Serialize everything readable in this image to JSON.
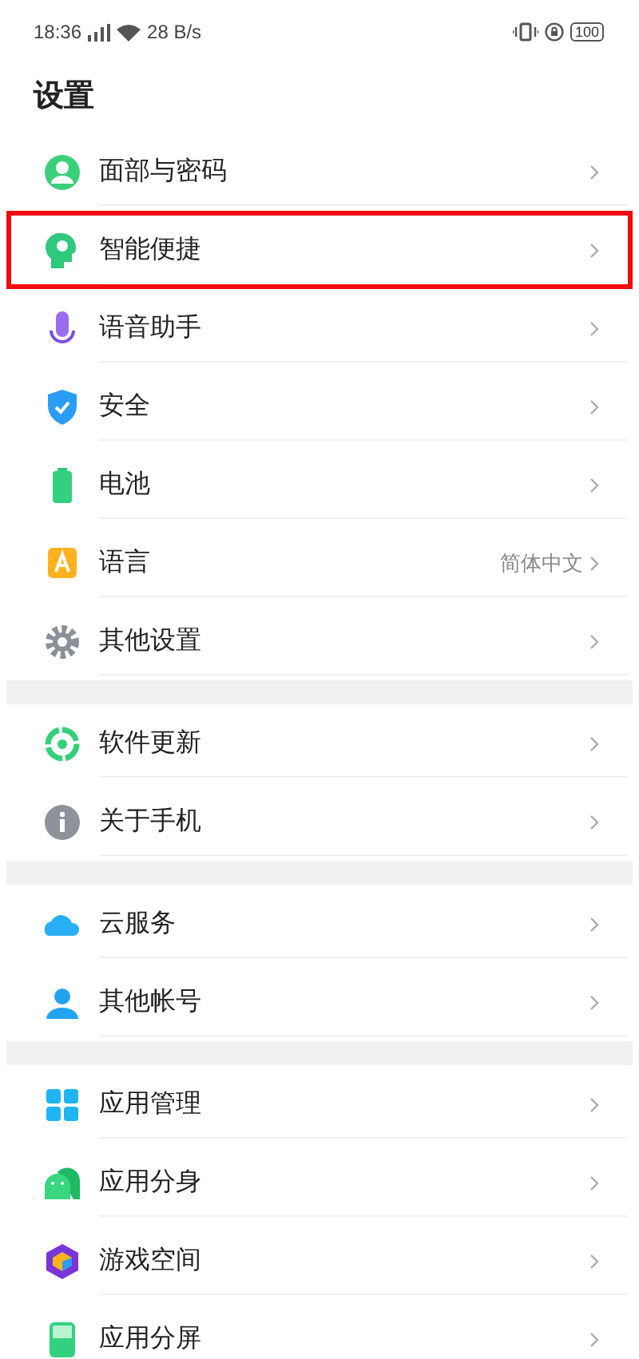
{
  "status_bar": {
    "time": "18:36",
    "speed": "28 B/s",
    "battery": "100"
  },
  "title": "设置",
  "groups": [
    {
      "items": [
        {
          "label": "面部与密码",
          "highlighted": false
        },
        {
          "label": "智能便捷",
          "highlighted": true
        },
        {
          "label": "语音助手",
          "highlighted": false
        },
        {
          "label": "安全",
          "highlighted": false
        },
        {
          "label": "电池",
          "highlighted": false
        },
        {
          "label": "语言",
          "value": "简体中文",
          "highlighted": false
        },
        {
          "label": "其他设置",
          "highlighted": false
        }
      ]
    },
    {
      "items": [
        {
          "label": "软件更新",
          "highlighted": false
        },
        {
          "label": "关于手机",
          "highlighted": false
        }
      ]
    },
    {
      "items": [
        {
          "label": "云服务",
          "highlighted": false
        },
        {
          "label": "其他帐号",
          "highlighted": false
        }
      ]
    },
    {
      "items": [
        {
          "label": "应用管理",
          "highlighted": false
        },
        {
          "label": "应用分身",
          "highlighted": false
        },
        {
          "label": "游戏空间",
          "highlighted": false
        },
        {
          "label": "应用分屏",
          "highlighted": false
        }
      ]
    }
  ]
}
